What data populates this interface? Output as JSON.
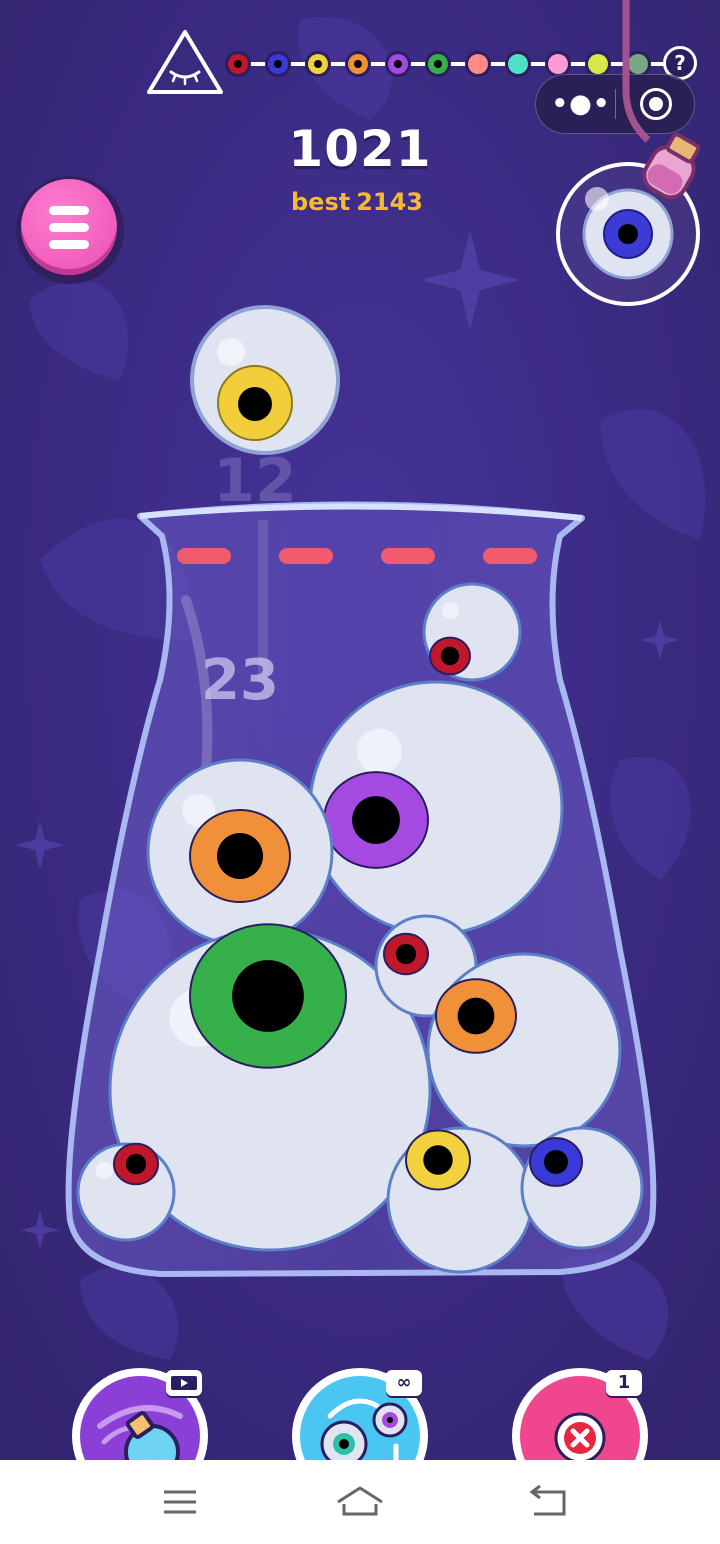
{
  "score": {
    "current": "1021",
    "best_label": "best",
    "best_value": "2143"
  },
  "help": {
    "label": "?"
  },
  "progression": {
    "colors": [
      "#c0172a",
      "#3a3ad8",
      "#f2d23c",
      "#f0913a",
      "#a44ae0",
      "#36b04a",
      "#ff8b84",
      "#4fe0c6",
      "#ff9ad6",
      "#d7e84a",
      "#7aa884"
    ]
  },
  "next_eye": {
    "iris_color": "#3b3bd6"
  },
  "held_eye": {
    "iris_color": "#f2cf3a"
  },
  "jar": {
    "drop_counter": "12",
    "jar_counter": "23",
    "eyes": [
      {
        "iris": "#c0172a"
      },
      {
        "iris": "#a44ae0"
      },
      {
        "iris": "#f0913a"
      },
      {
        "iris": "#36b04a"
      },
      {
        "iris": "#c0172a"
      },
      {
        "iris": "#f0913a"
      },
      {
        "iris": "#c0172a"
      },
      {
        "iris": "#f2d23c"
      },
      {
        "iris": "#3a3ad8"
      }
    ]
  },
  "powerups": [
    {
      "name": "potion",
      "badge": "video-icon",
      "bg": "#8a3fd6"
    },
    {
      "name": "swap",
      "badge": "∞",
      "bg": "#49c6f2"
    },
    {
      "name": "remove",
      "badge": "1",
      "bg": "#f0468e"
    }
  ],
  "nav": {
    "menu_icon": "hamburger-icon",
    "home_icon": "home-icon",
    "back_icon": "back-icon"
  },
  "colors": {
    "background": "#3d2c86",
    "accent_pink": "#e94cb3",
    "best_gold": "#f7b92e",
    "danger_line": "#f25a6e"
  }
}
